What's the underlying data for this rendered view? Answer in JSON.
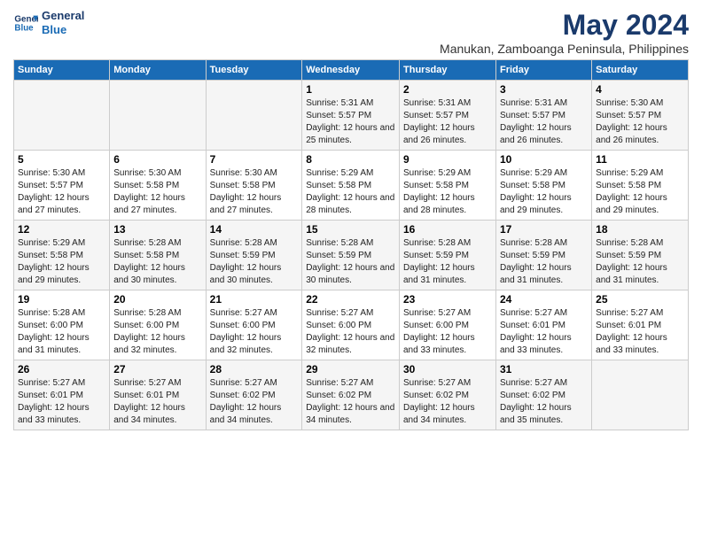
{
  "header": {
    "logo_line1": "General",
    "logo_line2": "Blue",
    "main_title": "May 2024",
    "subtitle": "Manukan, Zamboanga Peninsula, Philippines"
  },
  "calendar": {
    "days_of_week": [
      "Sunday",
      "Monday",
      "Tuesday",
      "Wednesday",
      "Thursday",
      "Friday",
      "Saturday"
    ],
    "weeks": [
      [
        {
          "day": "",
          "info": ""
        },
        {
          "day": "",
          "info": ""
        },
        {
          "day": "",
          "info": ""
        },
        {
          "day": "1",
          "info": "Sunrise: 5:31 AM\nSunset: 5:57 PM\nDaylight: 12 hours and 25 minutes."
        },
        {
          "day": "2",
          "info": "Sunrise: 5:31 AM\nSunset: 5:57 PM\nDaylight: 12 hours and 26 minutes."
        },
        {
          "day": "3",
          "info": "Sunrise: 5:31 AM\nSunset: 5:57 PM\nDaylight: 12 hours and 26 minutes."
        },
        {
          "day": "4",
          "info": "Sunrise: 5:30 AM\nSunset: 5:57 PM\nDaylight: 12 hours and 26 minutes."
        }
      ],
      [
        {
          "day": "5",
          "info": "Sunrise: 5:30 AM\nSunset: 5:57 PM\nDaylight: 12 hours and 27 minutes."
        },
        {
          "day": "6",
          "info": "Sunrise: 5:30 AM\nSunset: 5:58 PM\nDaylight: 12 hours and 27 minutes."
        },
        {
          "day": "7",
          "info": "Sunrise: 5:30 AM\nSunset: 5:58 PM\nDaylight: 12 hours and 27 minutes."
        },
        {
          "day": "8",
          "info": "Sunrise: 5:29 AM\nSunset: 5:58 PM\nDaylight: 12 hours and 28 minutes."
        },
        {
          "day": "9",
          "info": "Sunrise: 5:29 AM\nSunset: 5:58 PM\nDaylight: 12 hours and 28 minutes."
        },
        {
          "day": "10",
          "info": "Sunrise: 5:29 AM\nSunset: 5:58 PM\nDaylight: 12 hours and 29 minutes."
        },
        {
          "day": "11",
          "info": "Sunrise: 5:29 AM\nSunset: 5:58 PM\nDaylight: 12 hours and 29 minutes."
        }
      ],
      [
        {
          "day": "12",
          "info": "Sunrise: 5:29 AM\nSunset: 5:58 PM\nDaylight: 12 hours and 29 minutes."
        },
        {
          "day": "13",
          "info": "Sunrise: 5:28 AM\nSunset: 5:58 PM\nDaylight: 12 hours and 30 minutes."
        },
        {
          "day": "14",
          "info": "Sunrise: 5:28 AM\nSunset: 5:59 PM\nDaylight: 12 hours and 30 minutes."
        },
        {
          "day": "15",
          "info": "Sunrise: 5:28 AM\nSunset: 5:59 PM\nDaylight: 12 hours and 30 minutes."
        },
        {
          "day": "16",
          "info": "Sunrise: 5:28 AM\nSunset: 5:59 PM\nDaylight: 12 hours and 31 minutes."
        },
        {
          "day": "17",
          "info": "Sunrise: 5:28 AM\nSunset: 5:59 PM\nDaylight: 12 hours and 31 minutes."
        },
        {
          "day": "18",
          "info": "Sunrise: 5:28 AM\nSunset: 5:59 PM\nDaylight: 12 hours and 31 minutes."
        }
      ],
      [
        {
          "day": "19",
          "info": "Sunrise: 5:28 AM\nSunset: 6:00 PM\nDaylight: 12 hours and 31 minutes."
        },
        {
          "day": "20",
          "info": "Sunrise: 5:28 AM\nSunset: 6:00 PM\nDaylight: 12 hours and 32 minutes."
        },
        {
          "day": "21",
          "info": "Sunrise: 5:27 AM\nSunset: 6:00 PM\nDaylight: 12 hours and 32 minutes."
        },
        {
          "day": "22",
          "info": "Sunrise: 5:27 AM\nSunset: 6:00 PM\nDaylight: 12 hours and 32 minutes."
        },
        {
          "day": "23",
          "info": "Sunrise: 5:27 AM\nSunset: 6:00 PM\nDaylight: 12 hours and 33 minutes."
        },
        {
          "day": "24",
          "info": "Sunrise: 5:27 AM\nSunset: 6:01 PM\nDaylight: 12 hours and 33 minutes."
        },
        {
          "day": "25",
          "info": "Sunrise: 5:27 AM\nSunset: 6:01 PM\nDaylight: 12 hours and 33 minutes."
        }
      ],
      [
        {
          "day": "26",
          "info": "Sunrise: 5:27 AM\nSunset: 6:01 PM\nDaylight: 12 hours and 33 minutes."
        },
        {
          "day": "27",
          "info": "Sunrise: 5:27 AM\nSunset: 6:01 PM\nDaylight: 12 hours and 34 minutes."
        },
        {
          "day": "28",
          "info": "Sunrise: 5:27 AM\nSunset: 6:02 PM\nDaylight: 12 hours and 34 minutes."
        },
        {
          "day": "29",
          "info": "Sunrise: 5:27 AM\nSunset: 6:02 PM\nDaylight: 12 hours and 34 minutes."
        },
        {
          "day": "30",
          "info": "Sunrise: 5:27 AM\nSunset: 6:02 PM\nDaylight: 12 hours and 34 minutes."
        },
        {
          "day": "31",
          "info": "Sunrise: 5:27 AM\nSunset: 6:02 PM\nDaylight: 12 hours and 35 minutes."
        },
        {
          "day": "",
          "info": ""
        }
      ]
    ]
  }
}
